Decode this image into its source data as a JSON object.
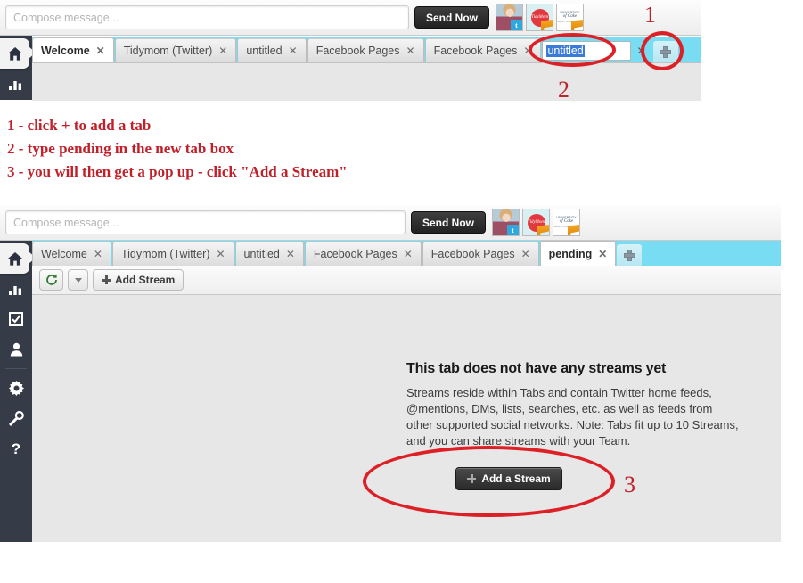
{
  "compose": {
    "placeholder": "Compose message...",
    "send_label": "Send Now"
  },
  "accounts": [
    {
      "name": "profile-photo",
      "network": "twitter",
      "badge": "t"
    },
    {
      "name": "tidymom-logo",
      "network": "facebook",
      "line1": "Tidy",
      "line2": "Mom"
    },
    {
      "name": "university-logo",
      "network": "facebook",
      "line1": "UNIVERSITY",
      "line2": "of Cake",
      "line3": "SHORT COURSES PRO"
    }
  ],
  "sidebar": {
    "items": [
      {
        "label": "Home",
        "icon": "home-icon",
        "active": true
      },
      {
        "label": "Analytics",
        "icon": "bar-chart-icon",
        "active": false
      },
      {
        "label": "Tasks",
        "icon": "checkbox-icon",
        "active": false
      },
      {
        "label": "Contacts",
        "icon": "person-icon",
        "active": false
      },
      {
        "label": "Settings",
        "icon": "gear-icon",
        "active": false
      },
      {
        "label": "Tools",
        "icon": "wrench-icon",
        "active": false
      },
      {
        "label": "Help",
        "icon": "question-icon",
        "active": false
      }
    ]
  },
  "screen_one": {
    "tabs": [
      {
        "label": "Welcome",
        "active": true
      },
      {
        "label": "Tidymom (Twitter)",
        "active": false
      },
      {
        "label": "untitled",
        "active": false
      },
      {
        "label": "Facebook Pages",
        "active": false
      },
      {
        "label": "Facebook Pages",
        "active": false
      }
    ],
    "new_tab_input_value": "untitled",
    "close_glyph": "✕",
    "add_tab_label": "+"
  },
  "screen_two": {
    "tabs": [
      {
        "label": "Welcome",
        "active": false
      },
      {
        "label": "Tidymom (Twitter)",
        "active": false
      },
      {
        "label": "untitled",
        "active": false
      },
      {
        "label": "Facebook Pages",
        "active": false
      },
      {
        "label": "Facebook Pages",
        "active": false
      },
      {
        "label": "pending",
        "active": true
      }
    ],
    "close_glyph": "✕",
    "toolbar": {
      "refresh_label": "↻",
      "add_stream_label": "Add Stream"
    },
    "empty_state": {
      "title": "This tab does not have any streams yet",
      "description": "Streams reside within Tabs and contain Twitter home feeds, @mentions, DMs, lists, searches, etc. as well as feeds from other supported social networks. Note: Tabs fit up to 10 Streams, and you can share streams with your Team.",
      "button_label": "Add a Stream"
    }
  },
  "annotations": {
    "step1_text": "1 - click + to add a tab",
    "step2_text": "2 - type pending in the new tab box",
    "step3_text": "3 - you will then get a pop up - click \"Add a Stream\"",
    "marker1": "1",
    "marker2": "2",
    "marker3": "3",
    "color": "#c02029",
    "circle_color": "#dd1f26"
  }
}
